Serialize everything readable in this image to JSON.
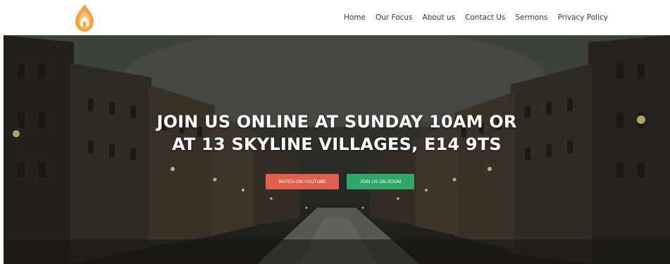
{
  "header": {
    "logo_icon": "church-flame-logo",
    "nav": [
      {
        "label": "Home"
      },
      {
        "label": "Our Focus"
      },
      {
        "label": "About us"
      },
      {
        "label": "Contact Us"
      },
      {
        "label": "Sermons"
      },
      {
        "label": "Privacy Policy"
      }
    ]
  },
  "hero": {
    "title_line1": "JOIN US ONLINE AT SUNDAY 10AM OR",
    "title_line2": "AT 13 SKYLINE VILLAGES, E14 9TS",
    "buttons": {
      "youtube": "WATCH ON YOUTUBE",
      "zoom": "JOIN US ON ZOOM"
    }
  },
  "colors": {
    "accent_orange": "#f0a341",
    "youtube_button": "#e0604f",
    "zoom_button": "#2fa86c"
  }
}
